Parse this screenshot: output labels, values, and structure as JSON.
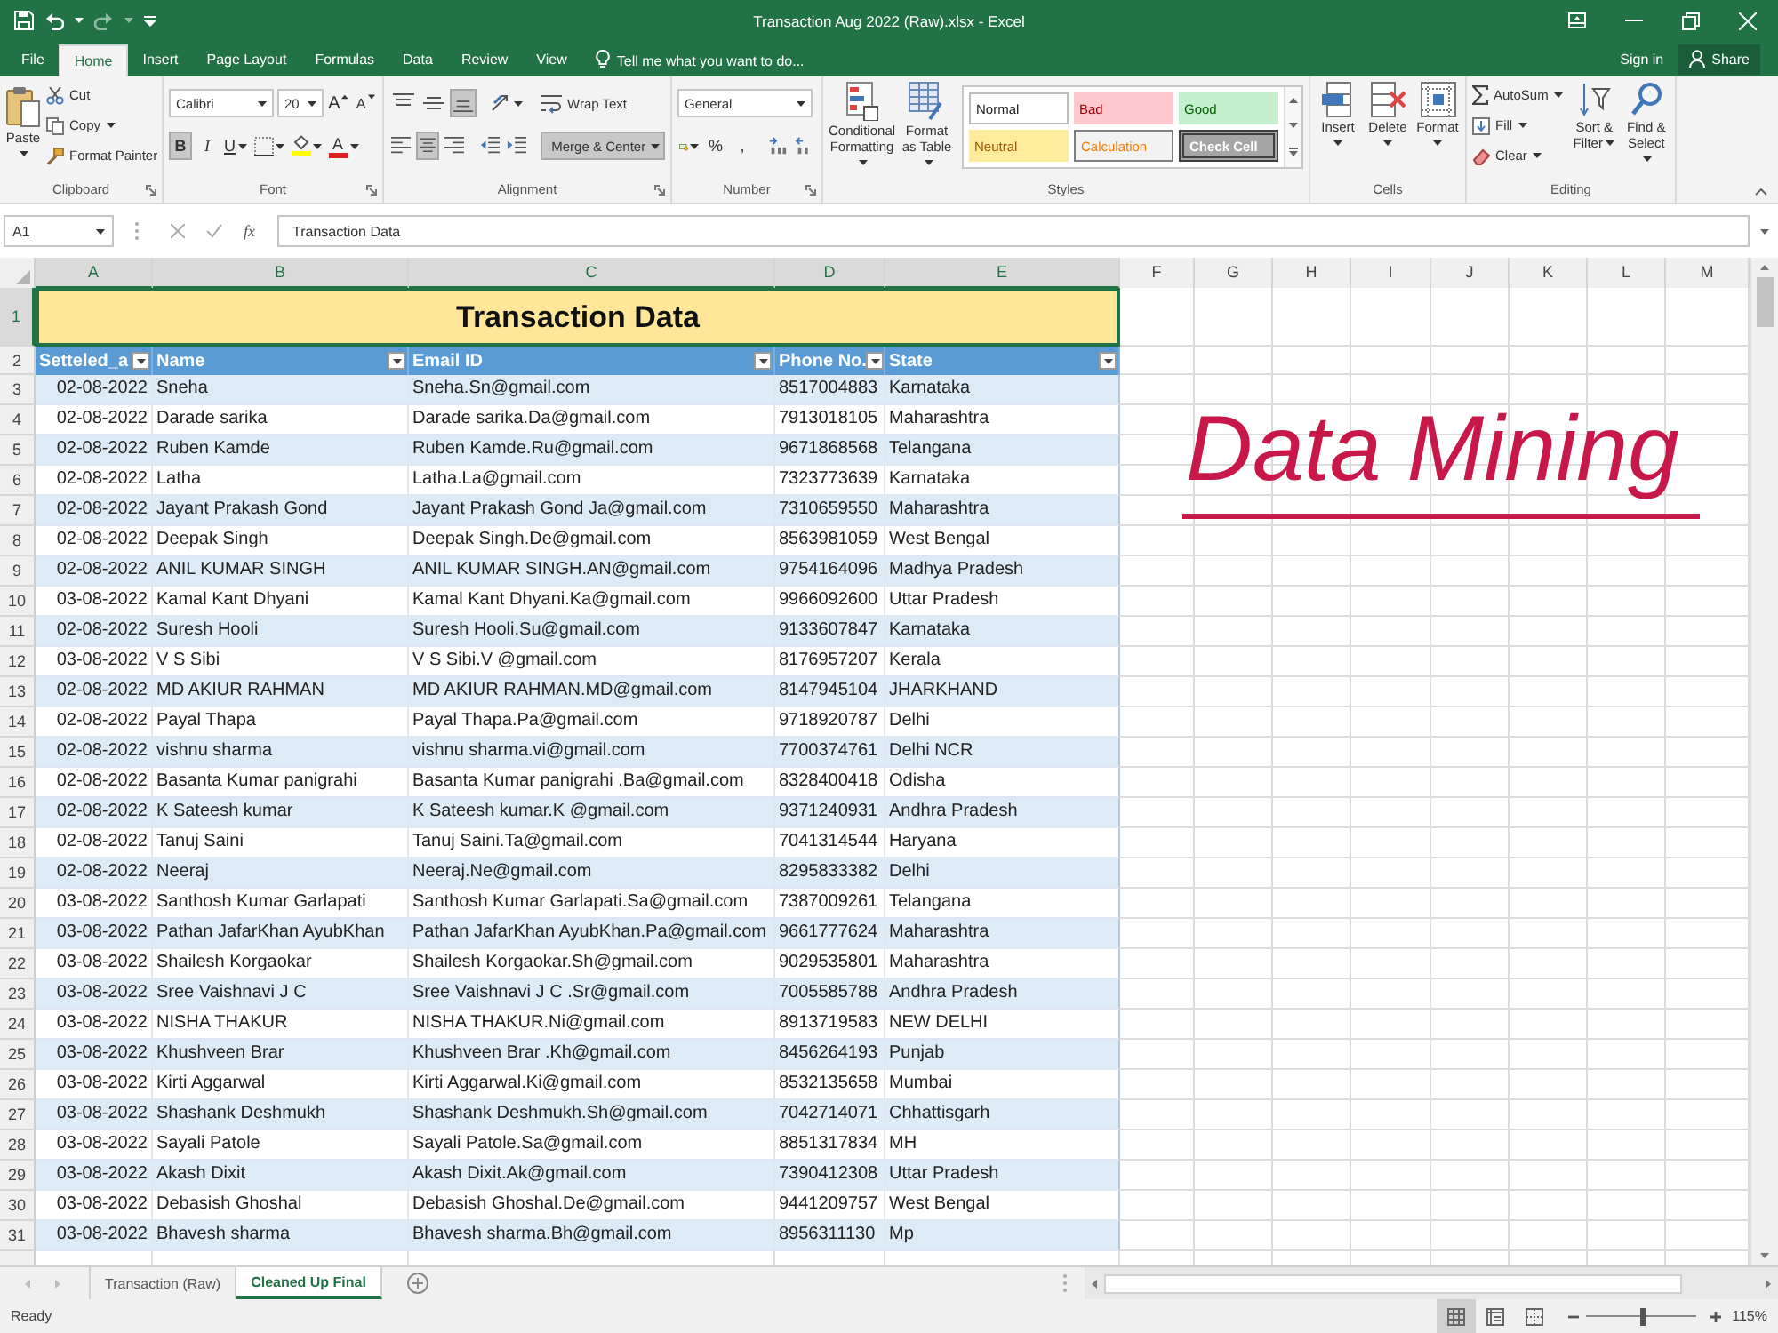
{
  "window": {
    "title": "Transaction Aug 2022 (Raw).xlsx - Excel"
  },
  "ribbon_tabs": [
    {
      "label": "File",
      "selected": false
    },
    {
      "label": "Home",
      "selected": true
    },
    {
      "label": "Insert",
      "selected": false
    },
    {
      "label": "Page Layout",
      "selected": false
    },
    {
      "label": "Formulas",
      "selected": false
    },
    {
      "label": "Data",
      "selected": false
    },
    {
      "label": "Review",
      "selected": false
    },
    {
      "label": "View",
      "selected": false
    }
  ],
  "tell_me": {
    "placeholder": "Tell me what you want to do..."
  },
  "account": {
    "sign_in": "Sign in",
    "share": "Share"
  },
  "ribbon": {
    "clipboard": {
      "label": "Clipboard",
      "paste": "Paste",
      "items": [
        {
          "kind": "cut",
          "label": "Cut"
        },
        {
          "kind": "copy",
          "label": "Copy"
        },
        {
          "kind": "painter",
          "label": "Format Painter"
        }
      ]
    },
    "font": {
      "label": "Font",
      "family": "Calibri",
      "size": "20",
      "size_buttons": [
        {
          "kind": "grow",
          "glyph": "A"
        },
        {
          "kind": "shrink",
          "glyph": "A"
        }
      ],
      "toggles": [
        {
          "kind": "bold",
          "glyph": "B",
          "on": true
        },
        {
          "kind": "italic",
          "glyph": "I",
          "on": false
        },
        {
          "kind": "underline",
          "glyph": "U",
          "on": false
        }
      ],
      "font_color": "A"
    },
    "alignment": {
      "label": "Alignment",
      "vertical": [
        {
          "kind": "top",
          "on": false
        },
        {
          "kind": "middle",
          "on": false
        },
        {
          "kind": "bottom",
          "on": true
        }
      ],
      "horizontal": [
        {
          "kind": "left",
          "on": false
        },
        {
          "kind": "center",
          "on": true
        },
        {
          "kind": "right",
          "on": false
        }
      ],
      "wrap": {
        "label": "Wrap Text",
        "on": false
      },
      "merge": {
        "label": "Merge & Center",
        "on": true
      }
    },
    "number": {
      "label": "Number",
      "format": "General",
      "symbols": [
        "%",
        ","
      ]
    },
    "styles": {
      "label": "Styles",
      "conditional": "Conditional Formatting",
      "table": "Format as Table",
      "items": [
        {
          "label": "Normal",
          "kind": "normal"
        },
        {
          "label": "Bad",
          "kind": "bad"
        },
        {
          "label": "Good",
          "kind": "good"
        },
        {
          "label": "Neutral",
          "kind": "neutral"
        },
        {
          "label": "Calculation",
          "kind": "calculation"
        },
        {
          "label": "Check Cell",
          "kind": "check"
        }
      ]
    },
    "cells": {
      "label": "Cells",
      "items": [
        {
          "kind": "insert",
          "label": "Insert"
        },
        {
          "kind": "delete",
          "label": "Delete"
        },
        {
          "kind": "format",
          "label": "Format"
        }
      ]
    },
    "editing": {
      "label": "Editing",
      "items": [
        {
          "kind": "autosum",
          "label": "AutoSum"
        },
        {
          "kind": "fill",
          "label": "Fill"
        },
        {
          "kind": "clear",
          "label": "Clear"
        }
      ],
      "big": [
        {
          "kind": "sort",
          "label": "Sort & Filter"
        },
        {
          "kind": "find",
          "label": "Find & Select"
        }
      ]
    }
  },
  "formula_bar": {
    "name_box": "A1",
    "function_button": "fx",
    "value": "Transaction Data"
  },
  "columns": [
    {
      "letter": "A",
      "selected": true
    },
    {
      "letter": "B",
      "selected": true
    },
    {
      "letter": "C",
      "selected": true
    },
    {
      "letter": "D",
      "selected": true
    },
    {
      "letter": "E",
      "selected": true
    },
    {
      "letter": "F",
      "selected": false
    },
    {
      "letter": "G",
      "selected": false
    },
    {
      "letter": "H",
      "selected": false
    },
    {
      "letter": "I",
      "selected": false
    },
    {
      "letter": "J",
      "selected": false
    },
    {
      "letter": "K",
      "selected": false
    },
    {
      "letter": "L",
      "selected": false
    },
    {
      "letter": "M",
      "selected": false
    }
  ],
  "sheet": {
    "title_row": {
      "number": "1",
      "selected": true,
      "text": "Transaction Data"
    },
    "header_row": {
      "number": "2",
      "selected": false,
      "cells": [
        "Setteled_a",
        "Name",
        "Email ID",
        "Phone No.",
        "State"
      ]
    },
    "rows": [
      {
        "number": "3",
        "selected": false,
        "cells": [
          "02-08-2022",
          "Sneha",
          "Sneha.Sn@gmail.com",
          "8517004883",
          "Karnataka"
        ]
      },
      {
        "number": "4",
        "selected": false,
        "cells": [
          "02-08-2022",
          "Darade sarika",
          "Darade sarika.Da@gmail.com",
          "7913018105",
          "Maharashtra"
        ]
      },
      {
        "number": "5",
        "selected": false,
        "cells": [
          "02-08-2022",
          "Ruben Kamde",
          "Ruben Kamde.Ru@gmail.com",
          "9671868568",
          "Telangana"
        ]
      },
      {
        "number": "6",
        "selected": false,
        "cells": [
          "02-08-2022",
          "Latha",
          "Latha.La@gmail.com",
          "7323773639",
          "Karnataka"
        ]
      },
      {
        "number": "7",
        "selected": false,
        "cells": [
          "02-08-2022",
          "Jayant Prakash Gond",
          "Jayant Prakash Gond Ja@gmail.com",
          "7310659550",
          "Maharashtra"
        ]
      },
      {
        "number": "8",
        "selected": false,
        "cells": [
          "02-08-2022",
          "Deepak Singh",
          "Deepak Singh.De@gmail.com",
          "8563981059",
          "West Bengal"
        ]
      },
      {
        "number": "9",
        "selected": false,
        "cells": [
          "02-08-2022",
          "ANIL KUMAR SINGH",
          "ANIL KUMAR SINGH.AN@gmail.com",
          "9754164096",
          "Madhya Pradesh"
        ]
      },
      {
        "number": "10",
        "selected": false,
        "cells": [
          "03-08-2022",
          "Kamal Kant Dhyani",
          "Kamal Kant Dhyani.Ka@gmail.com",
          "9966092600",
          "Uttar Pradesh"
        ]
      },
      {
        "number": "11",
        "selected": false,
        "cells": [
          "02-08-2022",
          "Suresh Hooli",
          "Suresh Hooli.Su@gmail.com",
          "9133607847",
          "Karnataka"
        ]
      },
      {
        "number": "12",
        "selected": false,
        "cells": [
          "03-08-2022",
          "V S Sibi",
          "V S Sibi.V @gmail.com",
          "8176957207",
          "Kerala"
        ]
      },
      {
        "number": "13",
        "selected": false,
        "cells": [
          "02-08-2022",
          "MD AKIUR RAHMAN",
          "MD AKIUR RAHMAN.MD@gmail.com",
          "8147945104",
          "JHARKHAND"
        ]
      },
      {
        "number": "14",
        "selected": false,
        "cells": [
          "02-08-2022",
          "Payal Thapa",
          "Payal Thapa.Pa@gmail.com",
          "9718920787",
          "Delhi"
        ]
      },
      {
        "number": "15",
        "selected": false,
        "cells": [
          "02-08-2022",
          "vishnu sharma",
          "vishnu sharma.vi@gmail.com",
          "7700374761",
          "Delhi NCR"
        ]
      },
      {
        "number": "16",
        "selected": false,
        "cells": [
          "02-08-2022",
          "Basanta Kumar panigrahi",
          "Basanta Kumar panigrahi .Ba@gmail.com",
          "8328400418",
          "Odisha"
        ]
      },
      {
        "number": "17",
        "selected": false,
        "cells": [
          "02-08-2022",
          "K Sateesh kumar",
          "K Sateesh kumar.K @gmail.com",
          "9371240931",
          "Andhra Pradesh"
        ]
      },
      {
        "number": "18",
        "selected": false,
        "cells": [
          "02-08-2022",
          "Tanuj Saini",
          "Tanuj Saini.Ta@gmail.com",
          "7041314544",
          "Haryana"
        ]
      },
      {
        "number": "19",
        "selected": false,
        "cells": [
          "02-08-2022",
          "Neeraj",
          "Neeraj.Ne@gmail.com",
          "8295833382",
          "Delhi"
        ]
      },
      {
        "number": "20",
        "selected": false,
        "cells": [
          "03-08-2022",
          "Santhosh Kumar Garlapati",
          "Santhosh Kumar Garlapati.Sa@gmail.com",
          "7387009261",
          "Telangana"
        ]
      },
      {
        "number": "21",
        "selected": false,
        "cells": [
          "03-08-2022",
          "Pathan JafarKhan AyubKhan",
          "Pathan JafarKhan AyubKhan.Pa@gmail.com",
          "9661777624",
          "Maharashtra"
        ]
      },
      {
        "number": "22",
        "selected": false,
        "cells": [
          "03-08-2022",
          "Shailesh Korgaokar",
          "Shailesh Korgaokar.Sh@gmail.com",
          "9029535801",
          "Maharashtra"
        ]
      },
      {
        "number": "23",
        "selected": false,
        "cells": [
          "03-08-2022",
          "Sree Vaishnavi J C",
          "Sree Vaishnavi J C .Sr@gmail.com",
          "7005585788",
          "Andhra Pradesh"
        ]
      },
      {
        "number": "24",
        "selected": false,
        "cells": [
          "03-08-2022",
          "NISHA THAKUR",
          "NISHA THAKUR.Ni@gmail.com",
          "8913719583",
          "NEW DELHI"
        ]
      },
      {
        "number": "25",
        "selected": false,
        "cells": [
          "03-08-2022",
          "Khushveen Brar",
          "Khushveen Brar .Kh@gmail.com",
          "8456264193",
          "Punjab"
        ]
      },
      {
        "number": "26",
        "selected": false,
        "cells": [
          "03-08-2022",
          "Kirti Aggarwal",
          "Kirti Aggarwal.Ki@gmail.com",
          "8532135658",
          "Mumbai"
        ]
      },
      {
        "number": "27",
        "selected": false,
        "cells": [
          "03-08-2022",
          "Shashank Deshmukh",
          "Shashank Deshmukh.Sh@gmail.com",
          "7042714071",
          "Chhattisgarh"
        ]
      },
      {
        "number": "28",
        "selected": false,
        "cells": [
          "03-08-2022",
          "Sayali Patole",
          "Sayali Patole.Sa@gmail.com",
          "8851317834",
          "MH"
        ]
      },
      {
        "number": "29",
        "selected": false,
        "cells": [
          "03-08-2022",
          "Akash Dixit",
          "Akash Dixit.Ak@gmail.com",
          "7390412308",
          "Uttar Pradesh"
        ]
      },
      {
        "number": "30",
        "selected": false,
        "cells": [
          "03-08-2022",
          "Debasish Ghoshal",
          "Debasish Ghoshal.De@gmail.com",
          "9441209757",
          "West Bengal"
        ]
      },
      {
        "number": "31",
        "selected": false,
        "cells": [
          "03-08-2022",
          "Bhavesh sharma",
          "Bhavesh sharma.Bh@gmail.com",
          "8956311130",
          "Mp"
        ]
      }
    ]
  },
  "annotation": {
    "text": "Data Mining"
  },
  "sheet_tabs": [
    {
      "label": "Transaction (Raw)",
      "selected": false
    },
    {
      "label": "Cleaned Up Final",
      "selected": true
    }
  ],
  "status_bar": {
    "status": "Ready",
    "views": [
      {
        "kind": "normal",
        "selected": true
      },
      {
        "kind": "page_layout",
        "selected": false
      },
      {
        "kind": "page_break",
        "selected": false
      }
    ],
    "zoom": {
      "level": 0.52,
      "reading": "115%"
    }
  }
}
